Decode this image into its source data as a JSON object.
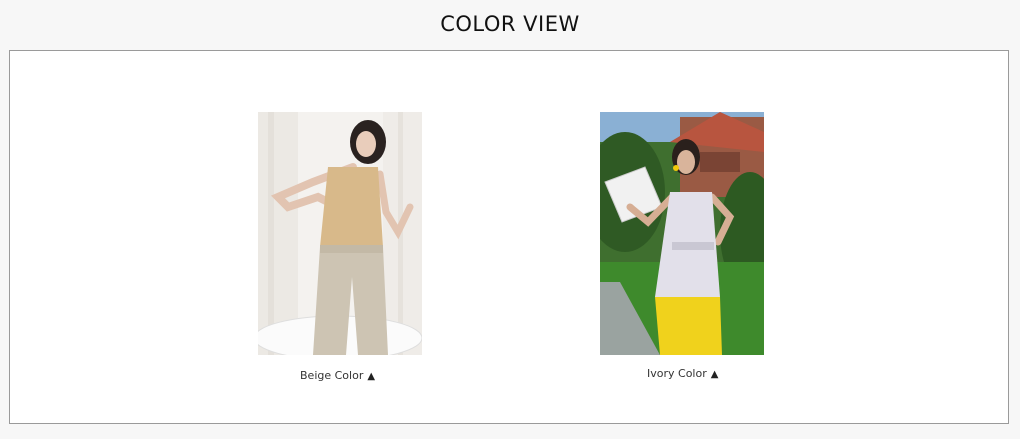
{
  "title": "COLOR VIEW",
  "items": [
    {
      "caption": "Beige Color",
      "icon": "triangle-up-icon"
    },
    {
      "caption": "Ivory Color",
      "icon": "triangle-up-icon"
    }
  ]
}
